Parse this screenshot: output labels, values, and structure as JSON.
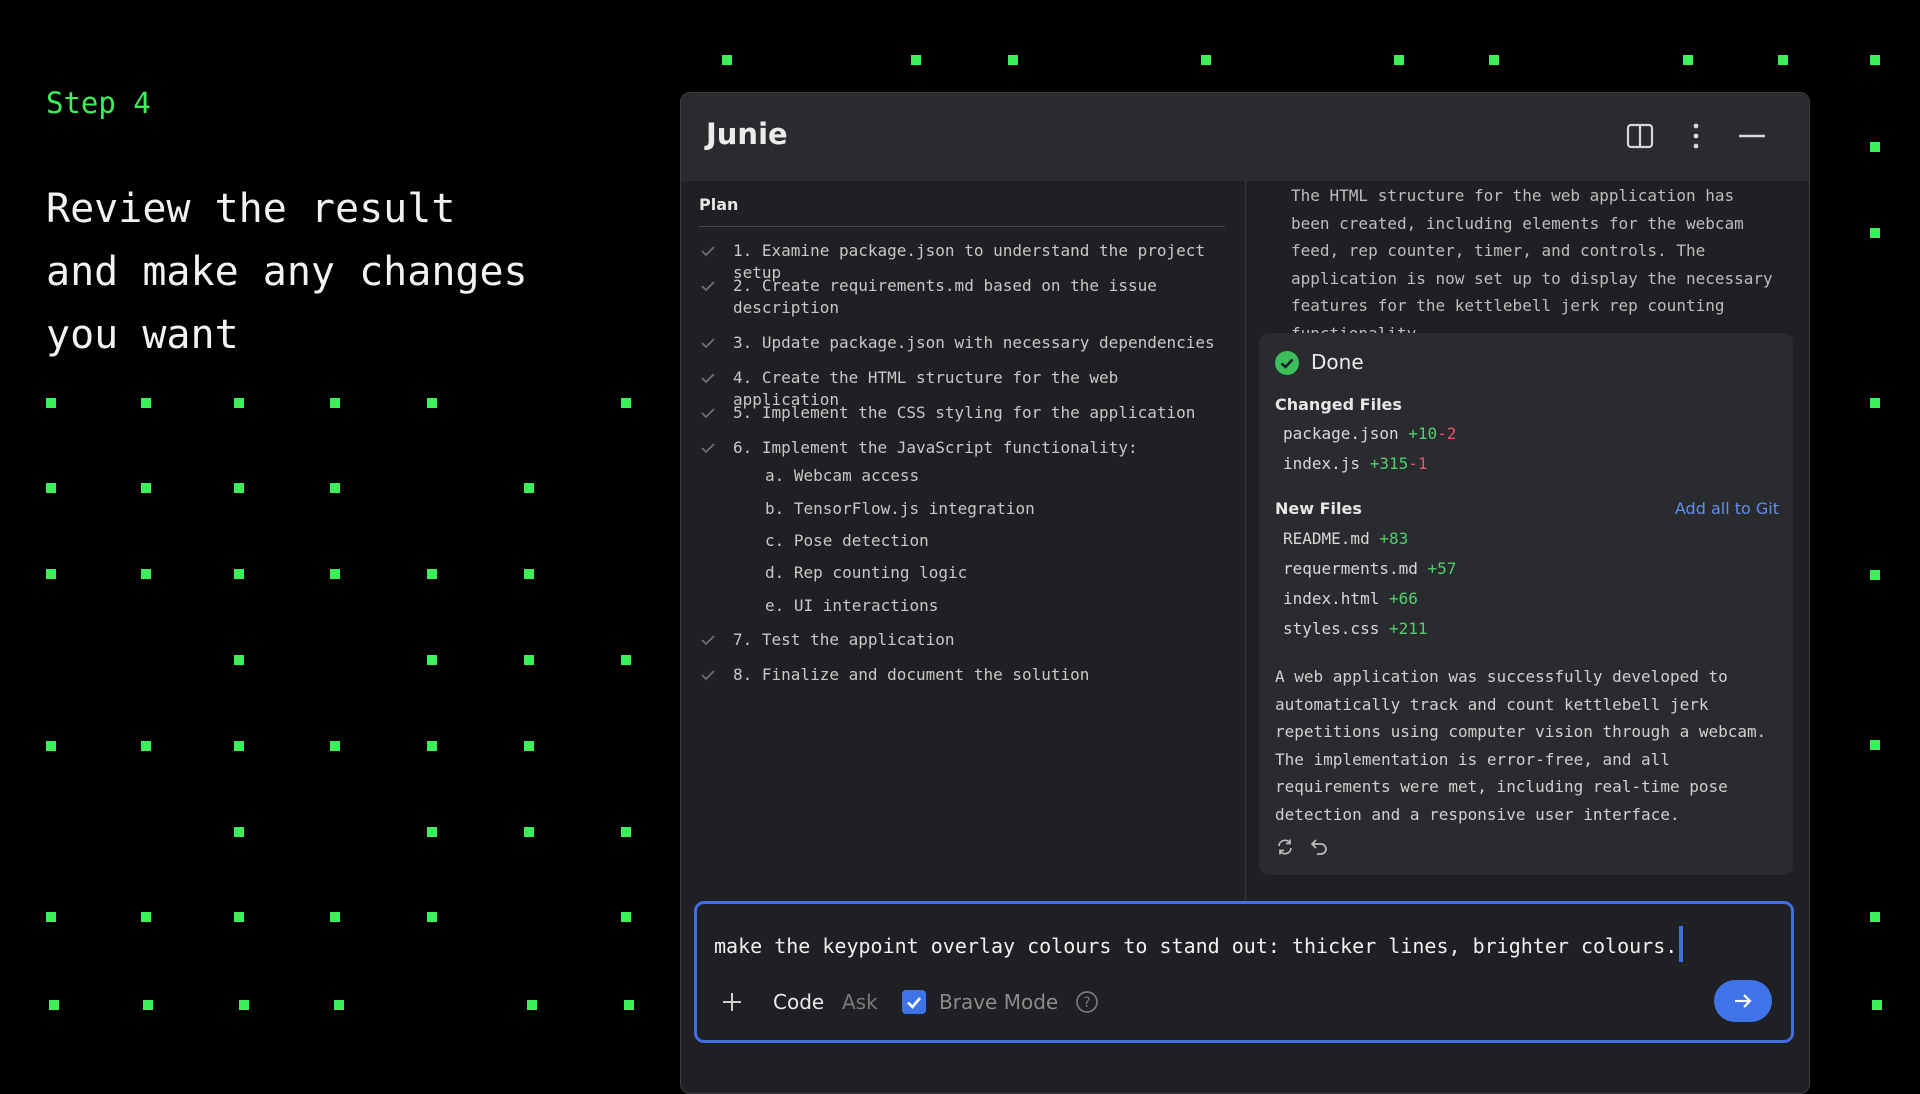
{
  "intro": {
    "step": "Step 4",
    "headline": "Review the result\nand make any changes\nyou want"
  },
  "panel": {
    "title": "Junie",
    "plan": {
      "title": "Plan",
      "steps": [
        "1. Examine package.json to understand the project setup",
        "2. Create requirements.md based on the issue description",
        "3. Update package.json with necessary dependencies",
        "4. Create the HTML structure for the web application",
        "5. Implement the CSS styling for the application",
        "6. Implement the JavaScript functionality:",
        "7. Test the application",
        "8. Finalize and document the solution"
      ],
      "substeps": [
        "a. Webcam access",
        "b. TensorFlow.js integration",
        "c. Pose detection",
        "d. Rep counting logic",
        "e. UI interactions"
      ]
    },
    "result": {
      "previous_text": "The HTML structure for the web application has been created, including elements for the webcam feed, rep counter, timer, and controls. The application is now set up to display the necessary features for the kettlebell jerk rep counting functionality.",
      "status": "Done",
      "changed_files_title": "Changed Files",
      "changed_files": [
        {
          "name": "package.json",
          "added": "+10",
          "removed": "-2"
        },
        {
          "name": "index.js",
          "added": "+315",
          "removed": "-1"
        }
      ],
      "new_files_title": "New Files",
      "add_all_label": "Add all to Git",
      "new_files": [
        {
          "name": "README.md",
          "added": "+83"
        },
        {
          "name": "requerments.md",
          "added": "+57"
        },
        {
          "name": "index.html",
          "added": "+66"
        },
        {
          "name": "styles.css",
          "added": "+211"
        }
      ],
      "summary": "A web application was successfully developed to automatically track and count kettlebell jerk repetitions using computer vision through a webcam. The implementation is error-free, and all requirements were met, including real-time pose detection and a responsive user interface."
    },
    "input": {
      "value": "make the keypoint overlay colours to stand out: thicker lines, brighter colours.",
      "mode_code": "Code",
      "mode_ask": "Ask",
      "brave_mode_label": "Brave Mode",
      "brave_mode_checked": true
    }
  },
  "colors": {
    "accent_green": "#3cf05a",
    "accent_blue": "#3f74e8",
    "diff_added": "#4fd06a",
    "diff_removed": "#e5536a"
  }
}
